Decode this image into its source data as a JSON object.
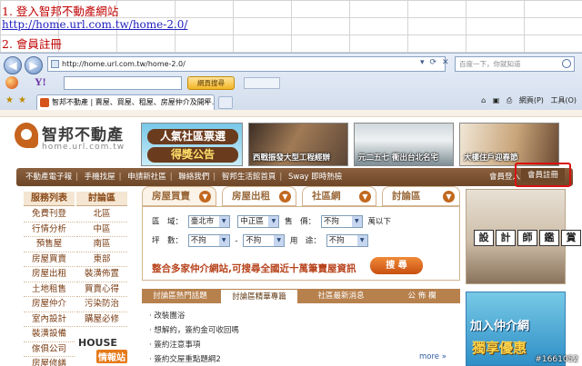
{
  "sheet": {
    "line1": "1.  登入智邦不動產網站",
    "line2": "http://home.url.com.tw/home-2.0/",
    "line3": "2. 會員註冊"
  },
  "browser": {
    "url": "http://home.url.com.tw/home-2.0/",
    "search_placeholder": "百度一下，你就知道",
    "yahoo_button": "網頁搜尋",
    "tab_title": "智邦不動產 | 賣屋、買屋、租屋、房屋仲介及開平...",
    "cmd_page": "網頁(P)",
    "cmd_tools": "工具(O)"
  },
  "site": {
    "logo_name": "智邦不動產",
    "logo_sub": "home.url.com.tw",
    "banner1_line1": "人氣社區票選",
    "banner1_line2": "得獎公告",
    "banner2_caption": "西戰振發大型工程經辦",
    "banner3_caption": "元二五七 衝出台北名宅",
    "banner4_caption": "大樓住戶迎春節",
    "menu": [
      "不動產電子報",
      "手機找屋",
      "申請新社區",
      "聯絡我們",
      "智邦生活館首頁",
      "Sway 即時熱檢"
    ],
    "login": "會員登入",
    "register": "會員註冊"
  },
  "sidebar": {
    "head_left": "服務列表",
    "head_right": "討論區",
    "left_items": [
      "免費刊登",
      "行情分析",
      "預售屋",
      "房屋買賣",
      "房屋出租",
      "土地租售",
      "房屋仲介",
      "室內設計",
      "裝潢設備",
      "傢俱公司",
      "房屋修繕"
    ],
    "right_items": [
      "北區",
      "中區",
      "南區",
      "東部",
      "裝潢佈置",
      "買賣心得",
      "污染防治",
      "購屋必修"
    ],
    "house_a": "HOUSE",
    "house_b": "情報站"
  },
  "search": {
    "tabs": [
      "房屋買賣",
      "房屋出租",
      "社區網",
      "討論區"
    ],
    "label_area": "區　域：",
    "city": "臺北市",
    "district": "中正區",
    "label_price": "售　價：",
    "price": "不拘",
    "price_suffix": "萬以下",
    "label_size": "坪　數：",
    "size_from": "不拘",
    "size_to": "不拘",
    "label_use": "用　途：",
    "use": "不拘",
    "promo": "整合多家仲介網站,可搜尋全國近十萬筆賣屋資訊",
    "search_button": "搜 尋"
  },
  "forum": {
    "tabs": [
      "討論區熱門話題",
      "討論區精華專篇",
      "社區最新消息",
      "公 佈 欄"
    ],
    "items": [
      "· 改裝團浴",
      "· 想解約，簽約金可收回嗎",
      "· 簽約注意事項",
      "· 簽約交屋重點題綱2"
    ],
    "more": "more »"
  },
  "ads": {
    "design": [
      "設",
      "計",
      "師",
      "鑑",
      "賞"
    ],
    "join_a": "加入仲介網",
    "join_b": "獨享優惠",
    "watermark": "#1661052"
  }
}
